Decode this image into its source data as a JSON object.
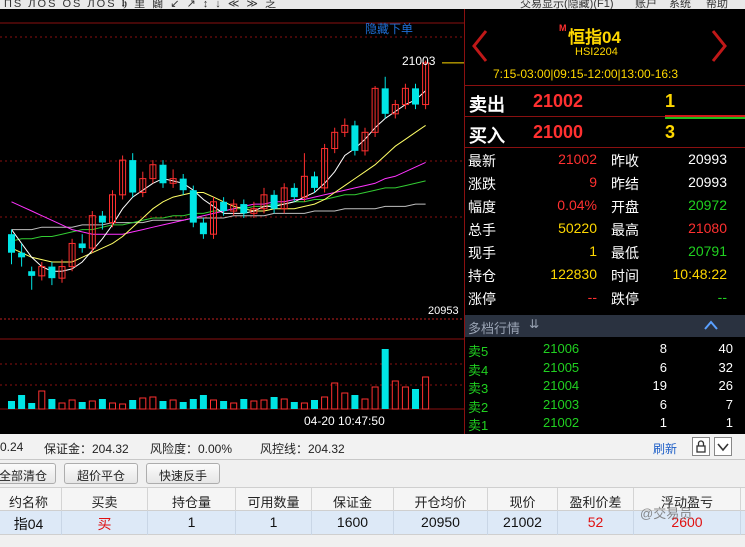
{
  "top_menu": {
    "toolbar_glyphs": "ПЅ ЛОЅ ОЅ ЛОЅ 𝖍 里 闢 ↙ ↗ ↕ ↓ ≪ ≫ 乏",
    "trade_display": "交易显示(隐藏)(F1)",
    "account": "账户",
    "system": "系统",
    "help": "帮助"
  },
  "chart": {
    "hide_link": "隐藏下单",
    "high_label": "21003",
    "low_label": "20953",
    "timestamp": "04-20 10:47:50",
    "colors": {
      "up": "#ff3030",
      "down": "#00e5e5",
      "ma5": "#ffffff",
      "ma10": "#ffff66",
      "ma20": "#ff33ff",
      "ma30": "#33cc33",
      "ma60": "#c0c0c0"
    },
    "candles": [
      {
        "o": 20928,
        "c": 20920,
        "h": 20930,
        "l": 20915
      },
      {
        "o": 20920,
        "c": 20918,
        "h": 20924,
        "l": 20914
      },
      {
        "o": 20912,
        "c": 20910,
        "h": 20914,
        "l": 20904
      },
      {
        "o": 20910,
        "c": 20914,
        "h": 20916,
        "l": 20908
      },
      {
        "o": 20914,
        "c": 20909,
        "h": 20916,
        "l": 20906
      },
      {
        "o": 20909,
        "c": 20914,
        "h": 20917,
        "l": 20907
      },
      {
        "o": 20914,
        "c": 20924,
        "h": 20926,
        "l": 20912
      },
      {
        "o": 20924,
        "c": 20922,
        "h": 20928,
        "l": 20920
      },
      {
        "o": 20922,
        "c": 20936,
        "h": 20938,
        "l": 20920
      },
      {
        "o": 20936,
        "c": 20933,
        "h": 20938,
        "l": 20930
      },
      {
        "o": 20933,
        "c": 20945,
        "h": 20947,
        "l": 20931
      },
      {
        "o": 20945,
        "c": 20960,
        "h": 20962,
        "l": 20943
      },
      {
        "o": 20960,
        "c": 20946,
        "h": 20963,
        "l": 20944
      },
      {
        "o": 20946,
        "c": 20952,
        "h": 20955,
        "l": 20944
      },
      {
        "o": 20952,
        "c": 20958,
        "h": 20960,
        "l": 20950
      },
      {
        "o": 20958,
        "c": 20950,
        "h": 20960,
        "l": 20948
      },
      {
        "o": 20950,
        "c": 20952,
        "h": 20956,
        "l": 20948
      },
      {
        "o": 20952,
        "c": 20947,
        "h": 20954,
        "l": 20945
      },
      {
        "o": 20947,
        "c": 20933,
        "h": 20949,
        "l": 20931
      },
      {
        "o": 20933,
        "c": 20928,
        "h": 20935,
        "l": 20926
      },
      {
        "o": 20928,
        "c": 20942,
        "h": 20944,
        "l": 20926
      },
      {
        "o": 20942,
        "c": 20938,
        "h": 20944,
        "l": 20936
      },
      {
        "o": 20938,
        "c": 20941,
        "h": 20943,
        "l": 20936
      },
      {
        "o": 20941,
        "c": 20937,
        "h": 20943,
        "l": 20935
      },
      {
        "o": 20937,
        "c": 20939,
        "h": 20942,
        "l": 20935
      },
      {
        "o": 20939,
        "c": 20945,
        "h": 20948,
        "l": 20937
      },
      {
        "o": 20945,
        "c": 20939,
        "h": 20947,
        "l": 20937
      },
      {
        "o": 20939,
        "c": 20948,
        "h": 20950,
        "l": 20937
      },
      {
        "o": 20948,
        "c": 20944,
        "h": 20950,
        "l": 20942
      },
      {
        "o": 20944,
        "c": 20953,
        "h": 20963,
        "l": 20942
      },
      {
        "o": 20953,
        "c": 20948,
        "h": 20955,
        "l": 20946
      },
      {
        "o": 20948,
        "c": 20965,
        "h": 20967,
        "l": 20946
      },
      {
        "o": 20965,
        "c": 20972,
        "h": 20974,
        "l": 20963
      },
      {
        "o": 20972,
        "c": 20975,
        "h": 20978,
        "l": 20970
      },
      {
        "o": 20975,
        "c": 20964,
        "h": 20977,
        "l": 20962
      },
      {
        "o": 20964,
        "c": 20972,
        "h": 20974,
        "l": 20962
      },
      {
        "o": 20972,
        "c": 20991,
        "h": 20992,
        "l": 20970
      },
      {
        "o": 20991,
        "c": 20980,
        "h": 20996,
        "l": 20978
      },
      {
        "o": 20980,
        "c": 20984,
        "h": 20986,
        "l": 20978
      },
      {
        "o": 20984,
        "c": 20991,
        "h": 20993,
        "l": 20982
      },
      {
        "o": 20991,
        "c": 20984,
        "h": 20993,
        "l": 20982
      },
      {
        "o": 20984,
        "c": 21002,
        "h": 21003,
        "l": 20982
      }
    ],
    "ma5": [
      20930,
      20924,
      20918,
      20914,
      20912,
      20912,
      20913,
      20916,
      20921,
      20926,
      20932,
      20939,
      20944,
      20947,
      20950,
      20952,
      20951,
      20950,
      20947,
      20943,
      20940,
      20937,
      20937,
      20937,
      20938,
      20940,
      20940,
      20941,
      20942,
      20944,
      20946,
      20950,
      20955,
      20962,
      20965,
      20969,
      20974,
      20978,
      20981,
      20984,
      20986,
      20990
    ],
    "ma10": [
      20922,
      20920,
      20918,
      20917,
      20916,
      20916,
      20916,
      20918,
      20920,
      20922,
      20924,
      20927,
      20931,
      20935,
      20939,
      20942,
      20944,
      20945,
      20946,
      20946,
      20944,
      20942,
      20940,
      20939,
      20938,
      20938,
      20939,
      20939,
      20939,
      20940,
      20941,
      20943,
      20946,
      20949,
      20952,
      20955,
      20958,
      20962,
      20966,
      20969,
      20972,
      20975
    ],
    "ma20": [
      20942,
      20940,
      20938,
      20936,
      20934,
      20932,
      20930,
      20929,
      20928,
      20928,
      20928,
      20928,
      20929,
      20930,
      20931,
      20932,
      20933,
      20934,
      20935,
      20936,
      20937,
      20938,
      20939,
      20940,
      20941,
      20941,
      20942,
      20942,
      20943,
      20943,
      20944,
      20945,
      20946,
      20947,
      20948,
      20949,
      20950,
      20952,
      20953,
      20955,
      20957,
      20959
    ],
    "ma30": [
      20925,
      20926,
      20926,
      20927,
      20927,
      20928,
      20929,
      20930,
      20930,
      20931,
      20932,
      20932,
      20933,
      20934,
      20935,
      20935,
      20936,
      20936,
      20937,
      20937,
      20938,
      20938,
      20939,
      20939,
      20940,
      20940,
      20941,
      20941,
      20942,
      20942,
      20943,
      20943,
      20944,
      20945,
      20945,
      20946,
      20947,
      20948,
      20948,
      20949,
      20950,
      20951
    ],
    "ma60": [
      20930,
      20930,
      20930,
      20931,
      20931,
      20931,
      20931,
      20932,
      20932,
      20932,
      20933,
      20933,
      20933,
      20933,
      20934,
      20934,
      20934,
      20934,
      20935,
      20935,
      20935,
      20935,
      20936,
      20936,
      20936,
      20936,
      20937,
      20937,
      20937,
      20937,
      20938,
      20938,
      20938,
      20939,
      20939,
      20939,
      20939,
      20940,
      20940,
      20940,
      20941,
      20941
    ],
    "volumes": [
      8,
      14,
      6,
      18,
      10,
      6,
      9,
      7,
      8,
      10,
      6,
      5,
      9,
      11,
      12,
      8,
      9,
      7,
      10,
      14,
      9,
      8,
      6,
      10,
      8,
      9,
      12,
      10,
      7,
      6,
      9,
      12,
      26,
      16,
      14,
      10,
      22,
      60,
      28,
      22,
      20,
      32
    ]
  },
  "quote": {
    "mark": "M",
    "name": "恒指04",
    "code": "HSI2204",
    "session_hours": "7:15-03:00|09:15-12:00|13:00-16:3",
    "ask": {
      "label": "卖出",
      "price": "21002",
      "volume": "1"
    },
    "bid": {
      "label": "买入",
      "price": "21000",
      "volume": "3"
    },
    "stats": [
      {
        "label": "最新",
        "value": "21002",
        "color": "#ff3030",
        "label2": "昨收",
        "value2": "20993",
        "color2": "#ffffff"
      },
      {
        "label": "涨跌",
        "value": "9",
        "color": "#ff3030",
        "label2": "昨结",
        "value2": "20993",
        "color2": "#ffffff"
      },
      {
        "label": "幅度",
        "value": "0.04%",
        "color": "#ff3030",
        "label2": "开盘",
        "value2": "20972",
        "color2": "#20d020"
      },
      {
        "label": "总手",
        "value": "50220",
        "color": "#ffd800",
        "label2": "最高",
        "value2": "21080",
        "color2": "#ff3030"
      },
      {
        "label": "现手",
        "value": "1",
        "color": "#ffd800",
        "label2": "最低",
        "value2": "20791",
        "color2": "#20d020"
      },
      {
        "label": "持仓",
        "value": "122830",
        "color": "#ffd800",
        "label2": "时间",
        "value2": "10:48:22",
        "color2": "#ffd800"
      },
      {
        "label": "涨停",
        "value": "--",
        "color": "#ff3030",
        "label2": "跌停",
        "value2": "--",
        "color2": "#20d020"
      }
    ],
    "depth_title": "多档行情",
    "depth": [
      {
        "label": "卖5",
        "price": "21006",
        "n": "8",
        "v": "40"
      },
      {
        "label": "卖4",
        "price": "21005",
        "n": "6",
        "v": "32"
      },
      {
        "label": "卖3",
        "price": "21004",
        "n": "19",
        "v": "26"
      },
      {
        "label": "卖2",
        "price": "21003",
        "n": "6",
        "v": "7"
      },
      {
        "label": "卖1",
        "price": "21002",
        "n": "1",
        "v": "1"
      }
    ]
  },
  "account": {
    "available": "0.24",
    "margin": "保证金：204.32",
    "risk": "风险度：0.00%",
    "risk_line": "风控线：204.32",
    "refresh": "刷新",
    "buttons": [
      "全部清仓",
      "超价平仓",
      "快速反手"
    ],
    "headers": [
      "约名称",
      "买卖",
      "持仓量",
      "可用数量",
      "保证金",
      "开仓均价",
      "现价",
      "盈利价差",
      "浮动盈亏"
    ],
    "row": [
      "指04",
      "买",
      "1",
      "1",
      "1600",
      "20950",
      "21002",
      "52",
      "2600"
    ],
    "watermark": "@交易员"
  }
}
